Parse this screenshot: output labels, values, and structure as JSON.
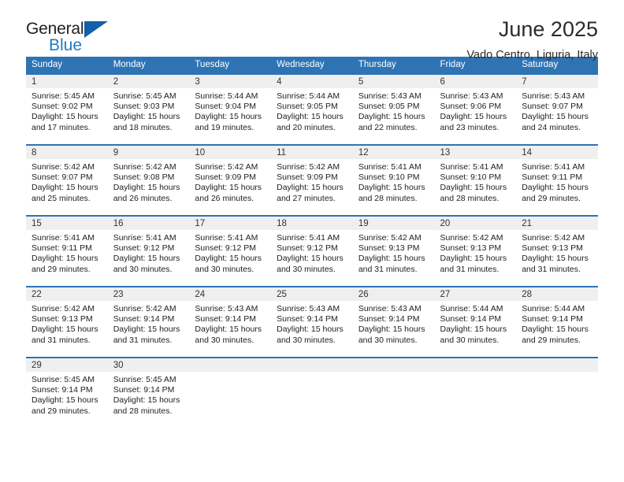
{
  "brand": {
    "name_part1": "General",
    "name_part2": "Blue",
    "triangle_icon": "triangle-icon"
  },
  "header": {
    "month_title": "June 2025",
    "location": "Vado Centro, Liguria, Italy",
    "accent_color": "#2e74b5",
    "band_color": "#efefef"
  },
  "weekdays": [
    "Sunday",
    "Monday",
    "Tuesday",
    "Wednesday",
    "Thursday",
    "Friday",
    "Saturday"
  ],
  "weeks": [
    [
      {
        "day": "1",
        "sunrise": "Sunrise: 5:45 AM",
        "sunset": "Sunset: 9:02 PM",
        "daylight1": "Daylight: 15 hours",
        "daylight2": "and 17 minutes."
      },
      {
        "day": "2",
        "sunrise": "Sunrise: 5:45 AM",
        "sunset": "Sunset: 9:03 PM",
        "daylight1": "Daylight: 15 hours",
        "daylight2": "and 18 minutes."
      },
      {
        "day": "3",
        "sunrise": "Sunrise: 5:44 AM",
        "sunset": "Sunset: 9:04 PM",
        "daylight1": "Daylight: 15 hours",
        "daylight2": "and 19 minutes."
      },
      {
        "day": "4",
        "sunrise": "Sunrise: 5:44 AM",
        "sunset": "Sunset: 9:05 PM",
        "daylight1": "Daylight: 15 hours",
        "daylight2": "and 20 minutes."
      },
      {
        "day": "5",
        "sunrise": "Sunrise: 5:43 AM",
        "sunset": "Sunset: 9:05 PM",
        "daylight1": "Daylight: 15 hours",
        "daylight2": "and 22 minutes."
      },
      {
        "day": "6",
        "sunrise": "Sunrise: 5:43 AM",
        "sunset": "Sunset: 9:06 PM",
        "daylight1": "Daylight: 15 hours",
        "daylight2": "and 23 minutes."
      },
      {
        "day": "7",
        "sunrise": "Sunrise: 5:43 AM",
        "sunset": "Sunset: 9:07 PM",
        "daylight1": "Daylight: 15 hours",
        "daylight2": "and 24 minutes."
      }
    ],
    [
      {
        "day": "8",
        "sunrise": "Sunrise: 5:42 AM",
        "sunset": "Sunset: 9:07 PM",
        "daylight1": "Daylight: 15 hours",
        "daylight2": "and 25 minutes."
      },
      {
        "day": "9",
        "sunrise": "Sunrise: 5:42 AM",
        "sunset": "Sunset: 9:08 PM",
        "daylight1": "Daylight: 15 hours",
        "daylight2": "and 26 minutes."
      },
      {
        "day": "10",
        "sunrise": "Sunrise: 5:42 AM",
        "sunset": "Sunset: 9:09 PM",
        "daylight1": "Daylight: 15 hours",
        "daylight2": "and 26 minutes."
      },
      {
        "day": "11",
        "sunrise": "Sunrise: 5:42 AM",
        "sunset": "Sunset: 9:09 PM",
        "daylight1": "Daylight: 15 hours",
        "daylight2": "and 27 minutes."
      },
      {
        "day": "12",
        "sunrise": "Sunrise: 5:41 AM",
        "sunset": "Sunset: 9:10 PM",
        "daylight1": "Daylight: 15 hours",
        "daylight2": "and 28 minutes."
      },
      {
        "day": "13",
        "sunrise": "Sunrise: 5:41 AM",
        "sunset": "Sunset: 9:10 PM",
        "daylight1": "Daylight: 15 hours",
        "daylight2": "and 28 minutes."
      },
      {
        "day": "14",
        "sunrise": "Sunrise: 5:41 AM",
        "sunset": "Sunset: 9:11 PM",
        "daylight1": "Daylight: 15 hours",
        "daylight2": "and 29 minutes."
      }
    ],
    [
      {
        "day": "15",
        "sunrise": "Sunrise: 5:41 AM",
        "sunset": "Sunset: 9:11 PM",
        "daylight1": "Daylight: 15 hours",
        "daylight2": "and 29 minutes."
      },
      {
        "day": "16",
        "sunrise": "Sunrise: 5:41 AM",
        "sunset": "Sunset: 9:12 PM",
        "daylight1": "Daylight: 15 hours",
        "daylight2": "and 30 minutes."
      },
      {
        "day": "17",
        "sunrise": "Sunrise: 5:41 AM",
        "sunset": "Sunset: 9:12 PM",
        "daylight1": "Daylight: 15 hours",
        "daylight2": "and 30 minutes."
      },
      {
        "day": "18",
        "sunrise": "Sunrise: 5:41 AM",
        "sunset": "Sunset: 9:12 PM",
        "daylight1": "Daylight: 15 hours",
        "daylight2": "and 30 minutes."
      },
      {
        "day": "19",
        "sunrise": "Sunrise: 5:42 AM",
        "sunset": "Sunset: 9:13 PM",
        "daylight1": "Daylight: 15 hours",
        "daylight2": "and 31 minutes."
      },
      {
        "day": "20",
        "sunrise": "Sunrise: 5:42 AM",
        "sunset": "Sunset: 9:13 PM",
        "daylight1": "Daylight: 15 hours",
        "daylight2": "and 31 minutes."
      },
      {
        "day": "21",
        "sunrise": "Sunrise: 5:42 AM",
        "sunset": "Sunset: 9:13 PM",
        "daylight1": "Daylight: 15 hours",
        "daylight2": "and 31 minutes."
      }
    ],
    [
      {
        "day": "22",
        "sunrise": "Sunrise: 5:42 AM",
        "sunset": "Sunset: 9:13 PM",
        "daylight1": "Daylight: 15 hours",
        "daylight2": "and 31 minutes."
      },
      {
        "day": "23",
        "sunrise": "Sunrise: 5:42 AM",
        "sunset": "Sunset: 9:14 PM",
        "daylight1": "Daylight: 15 hours",
        "daylight2": "and 31 minutes."
      },
      {
        "day": "24",
        "sunrise": "Sunrise: 5:43 AM",
        "sunset": "Sunset: 9:14 PM",
        "daylight1": "Daylight: 15 hours",
        "daylight2": "and 30 minutes."
      },
      {
        "day": "25",
        "sunrise": "Sunrise: 5:43 AM",
        "sunset": "Sunset: 9:14 PM",
        "daylight1": "Daylight: 15 hours",
        "daylight2": "and 30 minutes."
      },
      {
        "day": "26",
        "sunrise": "Sunrise: 5:43 AM",
        "sunset": "Sunset: 9:14 PM",
        "daylight1": "Daylight: 15 hours",
        "daylight2": "and 30 minutes."
      },
      {
        "day": "27",
        "sunrise": "Sunrise: 5:44 AM",
        "sunset": "Sunset: 9:14 PM",
        "daylight1": "Daylight: 15 hours",
        "daylight2": "and 30 minutes."
      },
      {
        "day": "28",
        "sunrise": "Sunrise: 5:44 AM",
        "sunset": "Sunset: 9:14 PM",
        "daylight1": "Daylight: 15 hours",
        "daylight2": "and 29 minutes."
      }
    ],
    [
      {
        "day": "29",
        "sunrise": "Sunrise: 5:45 AM",
        "sunset": "Sunset: 9:14 PM",
        "daylight1": "Daylight: 15 hours",
        "daylight2": "and 29 minutes."
      },
      {
        "day": "30",
        "sunrise": "Sunrise: 5:45 AM",
        "sunset": "Sunset: 9:14 PM",
        "daylight1": "Daylight: 15 hours",
        "daylight2": "and 28 minutes."
      },
      {
        "day": "",
        "sunrise": "",
        "sunset": "",
        "daylight1": "",
        "daylight2": ""
      },
      {
        "day": "",
        "sunrise": "",
        "sunset": "",
        "daylight1": "",
        "daylight2": ""
      },
      {
        "day": "",
        "sunrise": "",
        "sunset": "",
        "daylight1": "",
        "daylight2": ""
      },
      {
        "day": "",
        "sunrise": "",
        "sunset": "",
        "daylight1": "",
        "daylight2": ""
      },
      {
        "day": "",
        "sunrise": "",
        "sunset": "",
        "daylight1": "",
        "daylight2": ""
      }
    ]
  ]
}
